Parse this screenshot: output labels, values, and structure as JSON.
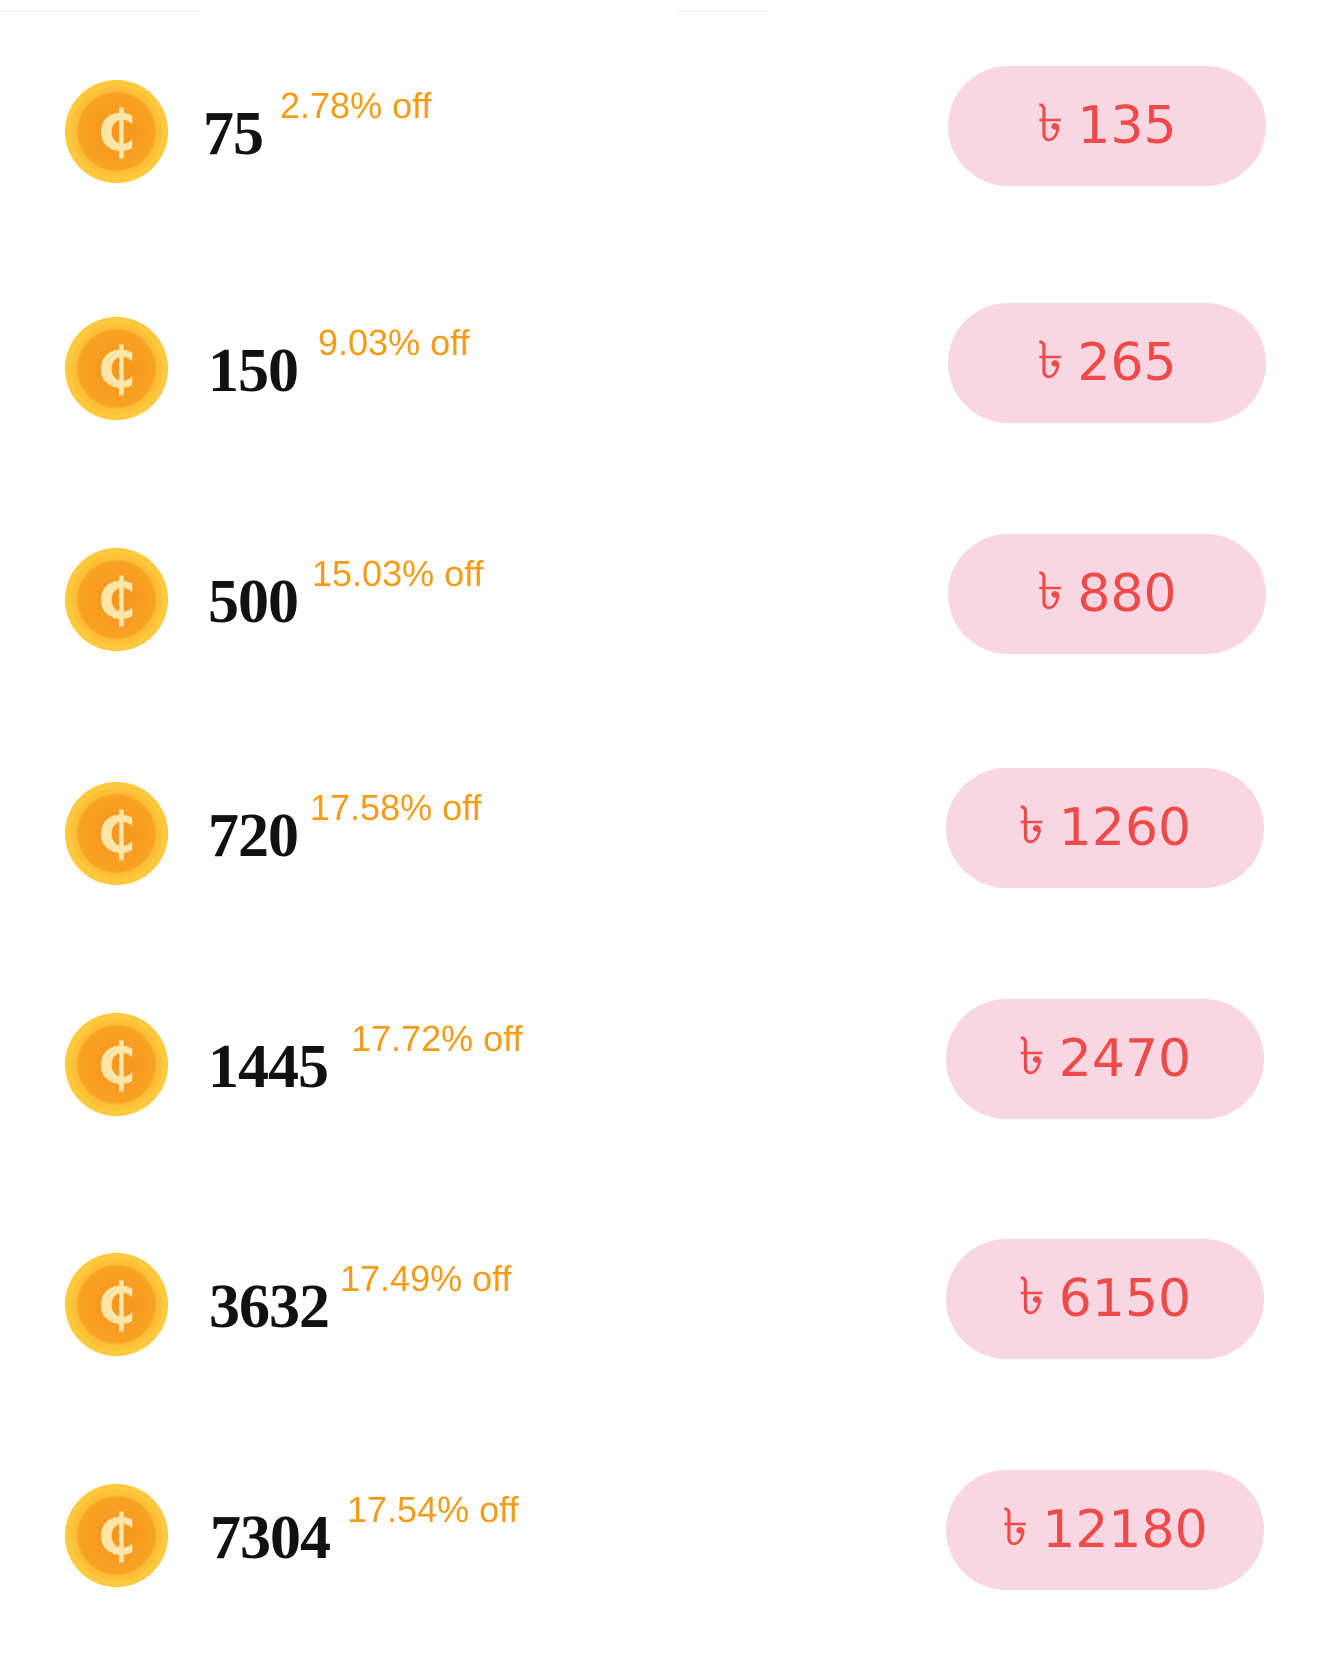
{
  "currency_symbol": "৳",
  "colors": {
    "coin": "#f8a225",
    "discount_text": "#f59c17",
    "price_button_bg": "#f8d7e2",
    "price_button_text": "#ef4a4a"
  },
  "packages": [
    {
      "coins": "75",
      "discount": "2.78% off",
      "price": "135"
    },
    {
      "coins": "150",
      "discount": "9.03% off",
      "price": "265"
    },
    {
      "coins": "500",
      "discount": "15.03% off",
      "price": "880"
    },
    {
      "coins": "720",
      "discount": "17.58% off",
      "price": "1260"
    },
    {
      "coins": "1445",
      "discount": "17.72% off",
      "price": "2470"
    },
    {
      "coins": "3632",
      "discount": "17.49% off",
      "price": "6150"
    },
    {
      "coins": "7304",
      "discount": "17.54% off",
      "price": "12180"
    }
  ]
}
